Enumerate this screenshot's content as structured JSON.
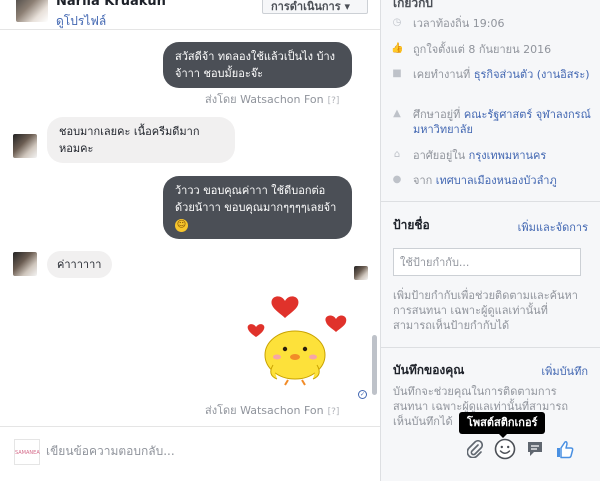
{
  "chat": {
    "name": "Narila Kruakun",
    "profile_link": "ดูโปรไฟล์",
    "actions_label": "การดำเนินการ ▾",
    "messages": [
      {
        "text": "สวัสดีจ้า ทดลองใช้แล้วเป็นไง บ้างจ้าาา ชอบมั้ยอะจ๊ะ"
      },
      {
        "sent_by": "ส่งโดย Watsachon Fon",
        "q": "[?]"
      },
      {
        "text": "ชอบมากเลยคะ เนื้อครีมดีมาก หอมคะ"
      },
      {
        "text": "ว้าวว ขอบคุณค่าาา ใช้ดีบอกต่อด้วยน้าาา ขอบคุณมากๆๆๆๆเลยจ้า",
        "emoji": "☺"
      },
      {
        "text": "ค่าาาาาา"
      },
      {
        "sent_by": "ส่งโดย Watsachon Fon",
        "q": "[?]"
      }
    ],
    "compose_placeholder": "เขียนข้อความตอบกลับ...",
    "compose_avatar_text": "SAMANEA"
  },
  "toolbar": {
    "tooltip": "โพสต์สติกเกอร์",
    "icons": [
      "paperclip-icon",
      "smiley-icon",
      "comment-icon",
      "thumbs-up-icon"
    ]
  },
  "info": {
    "title": "เกี่ยวกับ",
    "local_time": "เวลาท้องถิ่น 19:06",
    "liked_since": "ถูกใจตั้งแต่ 8 กันยายน 2016",
    "worked_at_prefix": "เคยทำงานที่ ",
    "worked_at_link": "ธุรกิจส่วนตัว (งานอิสระ)",
    "studied_prefix": "ศึกษาอยู่ที่ ",
    "studied_link": "คณะรัฐศาสตร์ จุฬาลงกรณ์มหาวิทยาลัย",
    "lives_prefix": "อาศัยอยู่ใน ",
    "lives_link": "กรุงเทพมหานคร",
    "from_prefix": "จาก ",
    "from_link": "เทศบาลเมืองหนองบัวลำภู",
    "tags_title": "ป้ายชื่อ",
    "tags_link": "เพิ่มและจัดการ",
    "tag_placeholder": "ใช้ป้ายกำกับ...",
    "tags_desc": "เพิ่มป้ายกำกับเพื่อช่วยติดตามและค้นหาการสนทนา เฉพาะผู้ดูแลเท่านั้นที่สามารถเห็นป้ายกำกับได้",
    "notes_title": "บันทึกของคุณ",
    "notes_link": "เพิ่มบันทึก",
    "notes_desc": "บันทึกจะช่วยคุณในการติดตามการสนทนา เฉพาะผู้ดูแลเท่านั้นที่สามารถเห็นบันทึกได้"
  }
}
